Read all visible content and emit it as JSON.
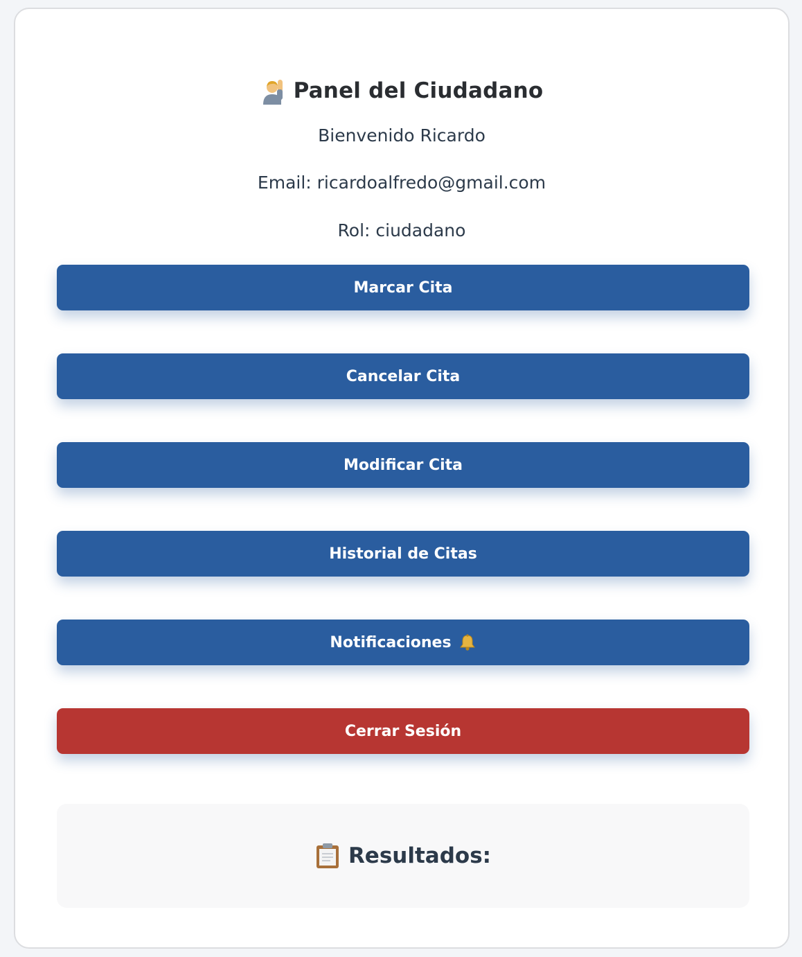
{
  "panel": {
    "title": "Panel del Ciudadano",
    "title_icon": "person-raising-hand-icon",
    "welcome": "Bienvenido Ricardo",
    "email_line": "Email: ricardoalfredo@gmail.com",
    "role_line": "Rol: ciudadano"
  },
  "actions": {
    "marcar_label": "Marcar Cita",
    "cancelar_label": "Cancelar Cita",
    "modificar_label": "Modificar Cita",
    "historial_label": "Historial de Citas",
    "notificaciones_label": "Notificaciones",
    "notificaciones_icon": "bell-icon",
    "logout_label": "Cerrar Sesión"
  },
  "results": {
    "title": "Resultados:",
    "icon": "clipboard-icon"
  },
  "colors": {
    "primary": "#2a5d9f",
    "danger": "#b73632",
    "page_background": "#f3f5f8"
  }
}
